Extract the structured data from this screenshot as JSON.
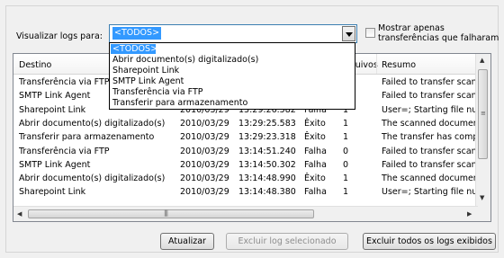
{
  "filter": {
    "label": "Visualizar logs para:",
    "selected": "<TODOS>",
    "options": [
      "<TODOS>",
      "Abrir documento(s) digitalizado(s)",
      "Sharepoint Link",
      "SMTP Link Agent",
      "Transferência via FTP",
      "Transferir para armazenamento"
    ]
  },
  "show_transfers": {
    "line1": "Mostrar apenas",
    "line2": "transferências que falharam",
    "checked": false
  },
  "table": {
    "columns": {
      "destino": "Destino",
      "arquivos": "rquivos",
      "resumo": "Resumo"
    },
    "rows": [
      {
        "destino": "Transferência via FTP",
        "data": "",
        "hora": "",
        "status": "",
        "arquivos": "",
        "resumo": "Failed to transfer scan"
      },
      {
        "destino": "SMTP Link Agent",
        "data": "",
        "hora": "",
        "status": "",
        "arquivos": "",
        "resumo": "Failed to transfer scan"
      },
      {
        "destino": "Sharepoint Link",
        "data": "2010/03/29",
        "hora": "13:29:26.582",
        "status": "Falha",
        "arquivos": "1",
        "resumo": "User=; Starting file num"
      },
      {
        "destino": "Abrir documento(s) digitalizado(s)",
        "data": "2010/03/29",
        "hora": "13:29:25.583",
        "status": "Êxito",
        "arquivos": "1",
        "resumo": "The scanned document"
      },
      {
        "destino": "Transferir para armazenamento",
        "data": "2010/03/29",
        "hora": "13:29:23.318",
        "status": "Êxito",
        "arquivos": "1",
        "resumo": "The transfer has compl"
      },
      {
        "destino": "Transferência via FTP",
        "data": "2010/03/29",
        "hora": "13:14:51.240",
        "status": "Falha",
        "arquivos": "0",
        "resumo": "Failed to transfer scan"
      },
      {
        "destino": "SMTP Link Agent",
        "data": "2010/03/29",
        "hora": "13:14:50.302",
        "status": "Falha",
        "arquivos": "0",
        "resumo": "Failed to transfer scan"
      },
      {
        "destino": "Abrir documento(s) digitalizado(s)",
        "data": "2010/03/29",
        "hora": "13:14:48.990",
        "status": "Êxito",
        "arquivos": "1",
        "resumo": "The scanned document"
      },
      {
        "destino": "Sharepoint Link",
        "data": "2010/03/29",
        "hora": "13:14:48.380",
        "status": "Falha",
        "arquivos": "1",
        "resumo": "User=; Starting file num"
      }
    ]
  },
  "buttons": {
    "refresh": "Atualizar",
    "delete_selected": "Excluir log selecionado",
    "delete_all": "Excluir todos os logs exibidos"
  }
}
